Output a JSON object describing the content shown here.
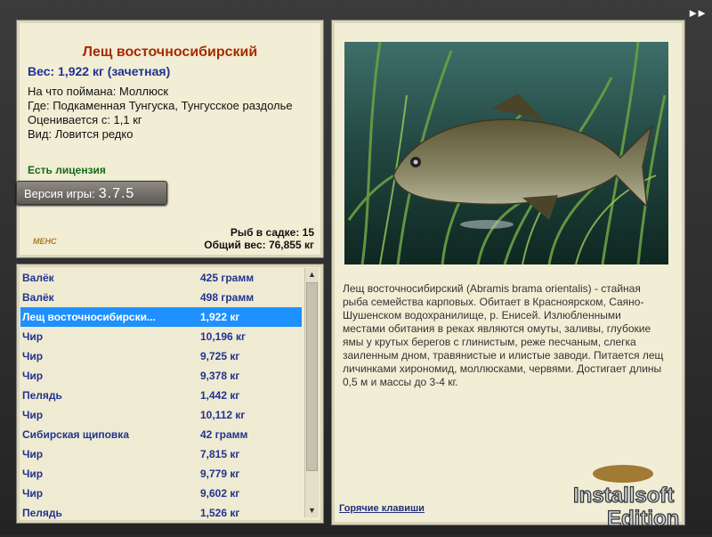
{
  "nav": {
    "skip_glyph": "►►"
  },
  "fish": {
    "title": "Лещ восточносибирский",
    "weight_line": "Вес: 1,922 кг (зачетная)",
    "bait": "На что поймана: Моллюск",
    "where": "Где: Подкаменная Тунгуска, Тунгусское раздолье",
    "value": "Оценивается с: 1,1 кг",
    "kind": "Вид: Ловится редко",
    "license": "Есть лицензия"
  },
  "version": {
    "label": "Версия игры:",
    "number": "3.7.5"
  },
  "small_logo": "МЕНС",
  "stats": {
    "count": "Рыб в садке: 15",
    "total": "Общий вес: 76,855 кг"
  },
  "catch_list": [
    {
      "name": "Валёк",
      "weight": "425 грамм"
    },
    {
      "name": "Валёк",
      "weight": "498 грамм"
    },
    {
      "name": "Лещ восточносибирски...",
      "weight": "1,922 кг"
    },
    {
      "name": "Чир",
      "weight": "10,196 кг"
    },
    {
      "name": "Чир",
      "weight": "9,725 кг"
    },
    {
      "name": "Чир",
      "weight": "9,378 кг"
    },
    {
      "name": "Пелядь",
      "weight": "1,442 кг"
    },
    {
      "name": "Чир",
      "weight": "10,112 кг"
    },
    {
      "name": "Сибирская щиповка",
      "weight": "42 грамм"
    },
    {
      "name": "Чир",
      "weight": "7,815 кг"
    },
    {
      "name": "Чир",
      "weight": "9,779 кг"
    },
    {
      "name": "Чир",
      "weight": "9,602 кг"
    },
    {
      "name": "Пелядь",
      "weight": "1,526 кг"
    }
  ],
  "selected_index": 2,
  "description": "Лещ восточносибирский (Abramis brama orientalis) - стайная рыба семейства карповых. Обитает в Красноярском, Саяно-Шушенском водохранилище, р. Енисей. Излюбленными местами обитания в реках являются омуты, заливы, глубокие ямы у крутых берегов с глинистым, реже песчаным, слегка заиленным дном, травянистые и илистые заводи. Питается лещ личинками хирономид, моллюсками, червями. Достигает длины 0,5 м и массы до 3-4 кг.",
  "hotkeys_link": "Горячие клавиши",
  "watermark": {
    "line1": "Installsoft",
    "line2": "Edition"
  },
  "colors": {
    "selection": "#1e90ff",
    "title": "#a82a00",
    "list_text": "#22338f"
  }
}
